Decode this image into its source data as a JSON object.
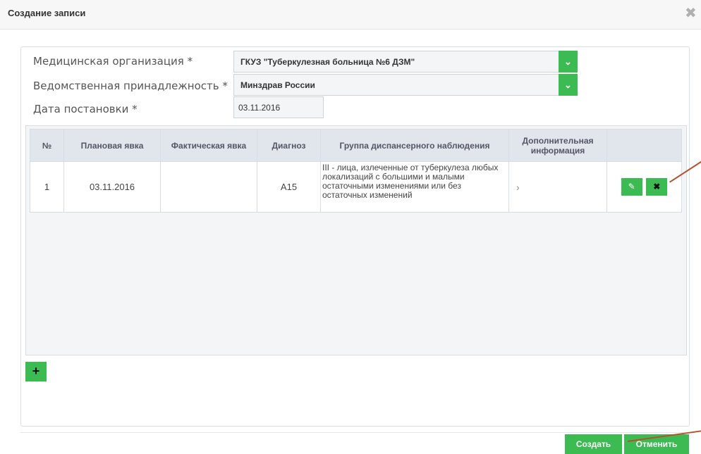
{
  "dialog": {
    "title": "Создание записи",
    "close_icon": "close-icon"
  },
  "form": {
    "org_label": "Медицинская организация *",
    "org_value": "ГКУЗ \"Туберкулезная больница №6 ДЗМ\"",
    "dept_label": "Ведомственная принадлежность *",
    "dept_value": "Минздрав России",
    "date_label": "Дата постановки *",
    "date_value": "03.11.2016"
  },
  "table": {
    "headers": {
      "num": "№",
      "planned": "Плановая явка",
      "actual": "Фактическая явка",
      "diagnosis": "Диагноз",
      "group": "Группа диспансерного наблюдения",
      "info": "Дополнительная информация"
    },
    "rows": [
      {
        "num": "1",
        "planned": "03.11.2016",
        "actual": "",
        "diagnosis": "A15",
        "group": "III - лица, излеченные от туберкулеза любых локализаций с большими и малыми остаточными изменениями или без остаточных изменений",
        "info": "›"
      }
    ]
  },
  "buttons": {
    "add": "+",
    "create": "Создать",
    "cancel": "Отменить"
  },
  "icons": {
    "edit": "edit-icon",
    "delete": "delete-icon",
    "select_arrow": "chevron-down-icon",
    "row_arrow": "chevron-right-icon"
  },
  "colors": {
    "accent": "#3dbb53",
    "annotation": "#b5522e"
  }
}
